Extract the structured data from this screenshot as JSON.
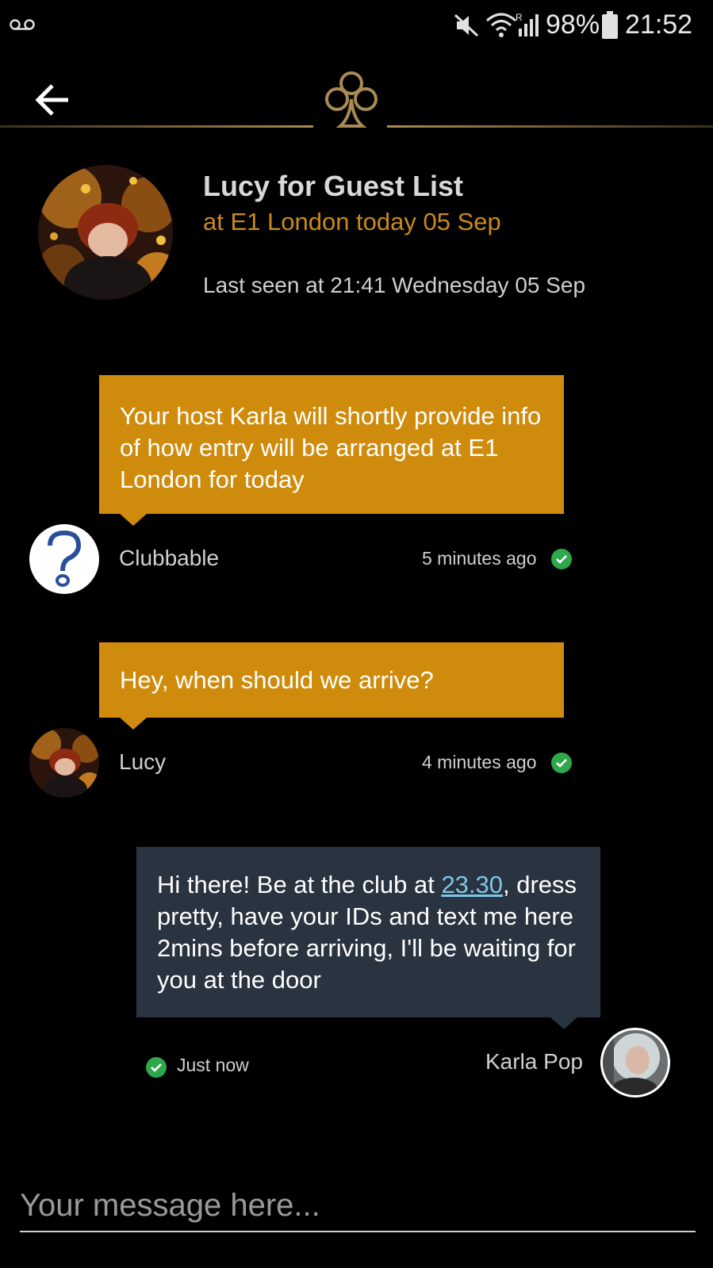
{
  "status_bar": {
    "left_icon": "voicemail-icon",
    "icons": [
      "mute-icon",
      "wifi-icon",
      "signal-icon",
      "battery-icon"
    ],
    "battery": "98%",
    "time": "21:52"
  },
  "header": {
    "back_icon": "back-arrow-icon",
    "logo_icon": "club-logo-icon",
    "accent_color": "#a88a52"
  },
  "profile": {
    "title": "Lucy for Guest List",
    "subtitle": "at E1 London today 05 Sep",
    "last_seen": "Last seen at 21:41 Wednesday 05 Sep"
  },
  "messages": [
    {
      "text": "Your host Karla will shortly provide info of how entry will be arranged at E1 London for today",
      "sender": "Clubbable",
      "time": "5 minutes ago"
    },
    {
      "text": "Hey, when should we arrive?",
      "sender": "Lucy",
      "time": "4 minutes ago"
    },
    {
      "text_before": "Hi there! Be at the club at ",
      "link": "23.30",
      "text_after": ", dress pretty, have your IDs and text me here 2mins before arriving, I'll be waiting for you at the door",
      "sender": "Karla Pop",
      "time": "Just now"
    }
  ],
  "composer": {
    "placeholder": "Your message here..."
  },
  "colors": {
    "bubble": "#cf8b0b",
    "bubble_dark": "#2a3340",
    "subtitle": "#c98a1c",
    "check": "#2ea84a"
  }
}
